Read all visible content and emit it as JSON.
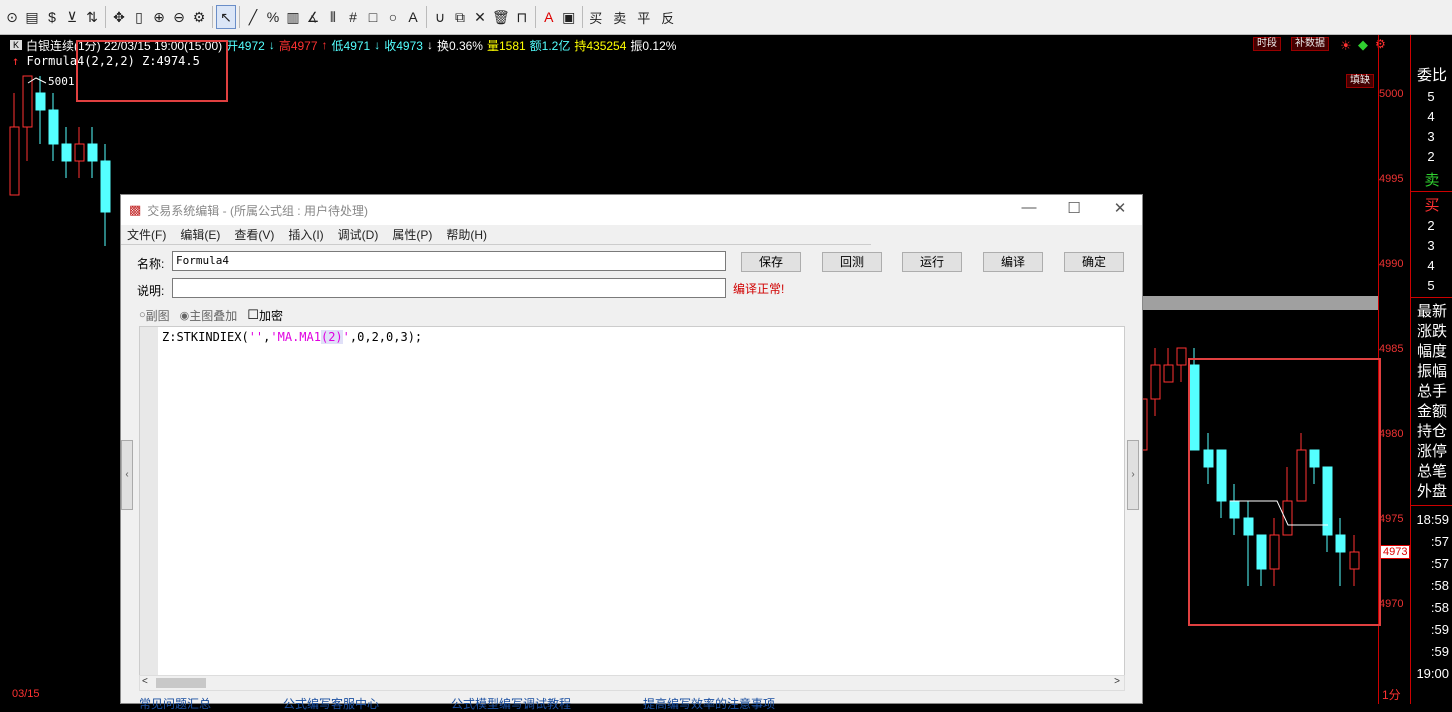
{
  "toolbar": {
    "items": [
      {
        "name": "circle-tool-icon",
        "glyph": "⊙"
      },
      {
        "name": "doc-icon",
        "glyph": "▤"
      },
      {
        "name": "dollar-icon",
        "glyph": "$"
      },
      {
        "name": "filter-icon",
        "glyph": "⊻"
      },
      {
        "name": "restore-icon",
        "glyph": "⇅"
      },
      {
        "name": "move-icon",
        "glyph": "✥"
      },
      {
        "name": "bar-icon",
        "glyph": "▯"
      },
      {
        "name": "zoom-in-icon",
        "glyph": "⊕"
      },
      {
        "name": "zoom-out-icon",
        "glyph": "⊖"
      },
      {
        "name": "gear-icon",
        "glyph": "⚙"
      },
      {
        "name": "pointer-icon",
        "glyph": "↖"
      },
      {
        "name": "line-icon",
        "glyph": "╱"
      },
      {
        "name": "percent-icon",
        "glyph": "%"
      },
      {
        "name": "ruler-icon",
        "glyph": "▥"
      },
      {
        "name": "angle-icon",
        "glyph": "∡"
      },
      {
        "name": "hbars-icon",
        "glyph": "⫴"
      },
      {
        "name": "grid-icon",
        "glyph": "#"
      },
      {
        "name": "rect-icon",
        "glyph": "□"
      },
      {
        "name": "ellipse-icon",
        "glyph": "○"
      },
      {
        "name": "text-icon",
        "glyph": "A"
      },
      {
        "name": "magnet-icon",
        "glyph": "∪"
      },
      {
        "name": "copy-icon",
        "glyph": "⧉"
      },
      {
        "name": "delete-icon",
        "glyph": "✕"
      },
      {
        "name": "trash-icon",
        "glyph": "🗑"
      },
      {
        "name": "lock-icon",
        "glyph": "⊓"
      },
      {
        "name": "font-color-icon",
        "glyph": "A"
      },
      {
        "name": "save-template-icon",
        "glyph": "▣"
      }
    ],
    "trade_buttons": [
      "买",
      "卖",
      "平",
      "反"
    ]
  },
  "info": {
    "k_label": "K",
    "name": "白银连续(1分) 22/03/15 19:00(15:00)",
    "open": "开4972",
    "high": "高4977",
    "low": "低4971",
    "close": "收4973",
    "turnover_rate": "换0.36%",
    "volume": "量1581",
    "amount": "额1.2亿",
    "open_interest": "持435254",
    "amplitude": "振0.12%"
  },
  "top_right_buttons": {
    "period": "时段",
    "fill": "补数据",
    "fill_gap": "填缺"
  },
  "formula_line": "Formula4(2,2,2) Z:4974.5",
  "peak_label": "5001",
  "date_label": "03/15",
  "period_label": "1分",
  "last_price_tag": "4973",
  "yaxis": {
    "ticks": [
      "5000",
      "4995",
      "4990",
      "4985",
      "4980",
      "4975",
      "4970"
    ]
  },
  "right_panel": {
    "title": "委比",
    "sell_levels": [
      "5",
      "4",
      "3",
      "2"
    ],
    "sell_label": "卖",
    "buy_label": "买",
    "buy_levels": [
      "2",
      "3",
      "4",
      "5"
    ],
    "fields": [
      "最新",
      "涨跌",
      "幅度",
      "振幅",
      "总手",
      "金额",
      "持仓",
      "涨停",
      "总笔",
      "外盘"
    ],
    "times": [
      "18:59",
      ":57",
      ":57",
      ":58",
      ":58",
      ":59",
      ":59",
      "19:00"
    ]
  },
  "dialog": {
    "title": "交易系统编辑 - (所属公式组 : 用户待处理)",
    "menu": [
      "文件(F)",
      "编辑(E)",
      "查看(V)",
      "插入(I)",
      "调试(D)",
      "属性(P)",
      "帮助(H)"
    ],
    "name_label": "名称:",
    "name_value": "Formula4",
    "desc_label": "说明:",
    "desc_value": "",
    "buttons": [
      "保存",
      "回测",
      "运行",
      "编译",
      "确定"
    ],
    "compile_status": "编译正常!",
    "options": {
      "sub_chart": "副图",
      "main_overlay": "主图叠加",
      "encrypt": "加密"
    },
    "code": {
      "prefix": "Z:STKINDIEX(",
      "q1": "''",
      ",": ",",
      "str": "'MA.MA1",
      "arg": "(2)",
      "q2": "'",
      "suffix": ",0,2,0,3);"
    },
    "footer_links": [
      "常见问题汇总",
      "公式编写客服中心",
      "公式模型编写调试教程",
      "提高编写效率的注意事项"
    ]
  },
  "colors": {
    "up": "#ff3232",
    "down": "#54ffff",
    "accent_red": "#e04040",
    "axis": "#cc0000"
  }
}
